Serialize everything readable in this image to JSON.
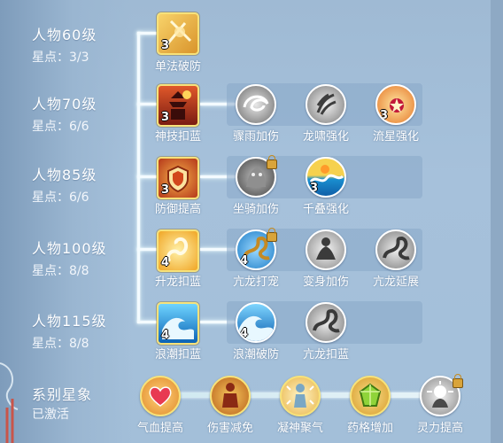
{
  "levels": [
    {
      "level": "人物60级",
      "stars": "星点：3/3"
    },
    {
      "level": "人物70级",
      "stars": "星点：6/6"
    },
    {
      "level": "人物85级",
      "stars": "星点：6/6"
    },
    {
      "level": "人物100级",
      "stars": "星点：8/8"
    },
    {
      "level": "人物115级",
      "stars": "星点：8/8"
    }
  ],
  "skills": {
    "r1": [
      {
        "label": "单法破防",
        "count": "3",
        "icon": "sword-burst-icon"
      }
    ],
    "r2": [
      {
        "label": "神技扣蓝",
        "count": "3",
        "icon": "pagoda-icon"
      },
      {
        "label": "骤雨加伤",
        "count": "",
        "icon": "swirl-icon"
      },
      {
        "label": "龙啸强化",
        "count": "",
        "icon": "claw-icon"
      },
      {
        "label": "流星强化",
        "count": "3",
        "icon": "meteor-icon"
      }
    ],
    "r3": [
      {
        "label": "防御提高",
        "count": "3",
        "icon": "shield-icon"
      },
      {
        "label": "坐骑加伤",
        "count": "",
        "icon": "beast-icon",
        "locked": true
      },
      {
        "label": "千叠强化",
        "count": "3",
        "icon": "wave-icon"
      }
    ],
    "r4": [
      {
        "label": "升龙扣蓝",
        "count": "4",
        "icon": "dragon-rise-icon"
      },
      {
        "label": "亢龙打宠",
        "count": "4",
        "icon": "dragon-icon",
        "locked": true
      },
      {
        "label": "变身加伤",
        "count": "",
        "icon": "meditate-icon"
      },
      {
        "label": "亢龙延展",
        "count": "",
        "icon": "dragon-gray-icon"
      }
    ],
    "r5": [
      {
        "label": "浪潮扣蓝",
        "count": "4",
        "icon": "tide-icon"
      },
      {
        "label": "浪潮破防",
        "count": "4",
        "icon": "tide-circle-icon"
      },
      {
        "label": "亢龙扣蓝",
        "count": "",
        "icon": "dragon-gray-icon"
      }
    ]
  },
  "series": {
    "title": "系别星象",
    "status": "已激活",
    "items": [
      {
        "label": "气血提高",
        "icon": "heart-icon"
      },
      {
        "label": "伤害减免",
        "icon": "armor-figure-icon"
      },
      {
        "label": "凝神聚气",
        "icon": "focus-figure-icon"
      },
      {
        "label": "药格增加",
        "icon": "gem-icon"
      },
      {
        "label": "灵力提高",
        "icon": "spirit-hand-icon",
        "locked": true
      }
    ]
  },
  "colors": {
    "gold_border": "#f7e27a",
    "label_white": "#ffffff",
    "connector": "#f4fbff"
  }
}
